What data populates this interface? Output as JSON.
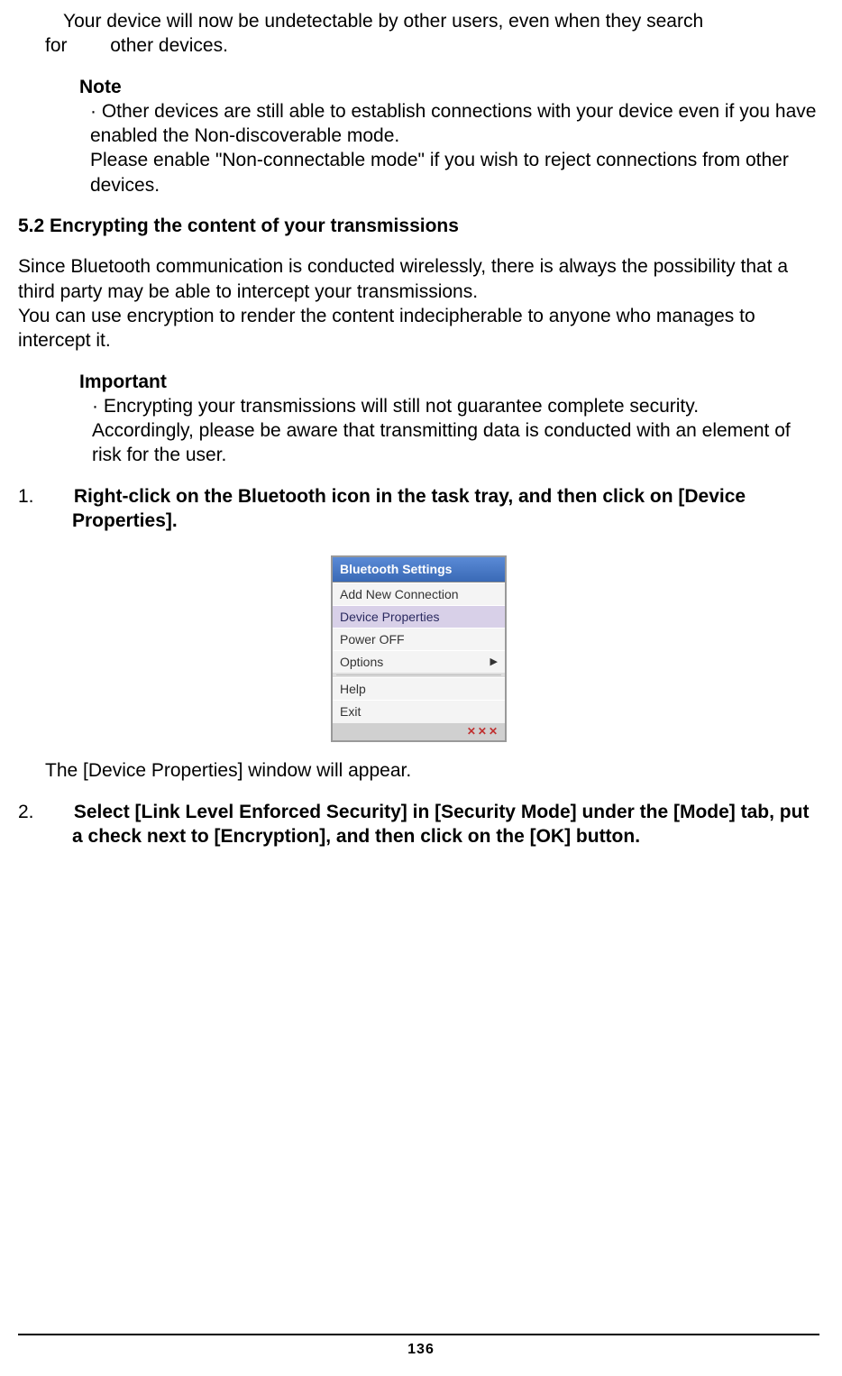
{
  "intro": {
    "line1_pre": "Your device will now be undetectable by other users, even when they search",
    "line1_for": "for",
    "line1_post": "other devices."
  },
  "note": {
    "label": "Note",
    "bullet": "· Other devices are still able to establish connections with your device even if you  have enabled the Non-discoverable mode.",
    "cont1": "Please enable \"Non-connectable mode\" if you wish to reject connections from    other devices."
  },
  "section": {
    "heading": "5.2  Encrypting the content of your transmissions"
  },
  "body": {
    "p1": "Since Bluetooth communication is conducted wirelessly, there is always the possibility that a third party may be able to intercept your transmissions.",
    "p2": "You can use encryption to render the content indecipherable to anyone who manages to intercept it."
  },
  "important": {
    "label": "Important",
    "bullet": "· Encrypting your transmissions will still not guarantee complete security.",
    "cont": "Accordingly, please be aware that transmitting data is conducted with an element of risk for the user."
  },
  "steps": {
    "s1_num": "1.",
    "s1_text": "Right-click on the Bluetooth icon in the task tray, and then click on [Device Properties].",
    "s1_after": "The [Device Properties] window will appear.",
    "s2_num": "2.",
    "s2_text": "Select [Link Level Enforced Security] in [Security Mode] under the [Mode] tab, put a check next to [Encryption], and then click on the [OK] button."
  },
  "menu": {
    "title": "Bluetooth Settings",
    "items": {
      "add": "Add New Connection",
      "props": "Device Properties",
      "power": "Power OFF",
      "options": "Options",
      "help": "Help",
      "exit": "Exit"
    }
  },
  "page_number": "136"
}
